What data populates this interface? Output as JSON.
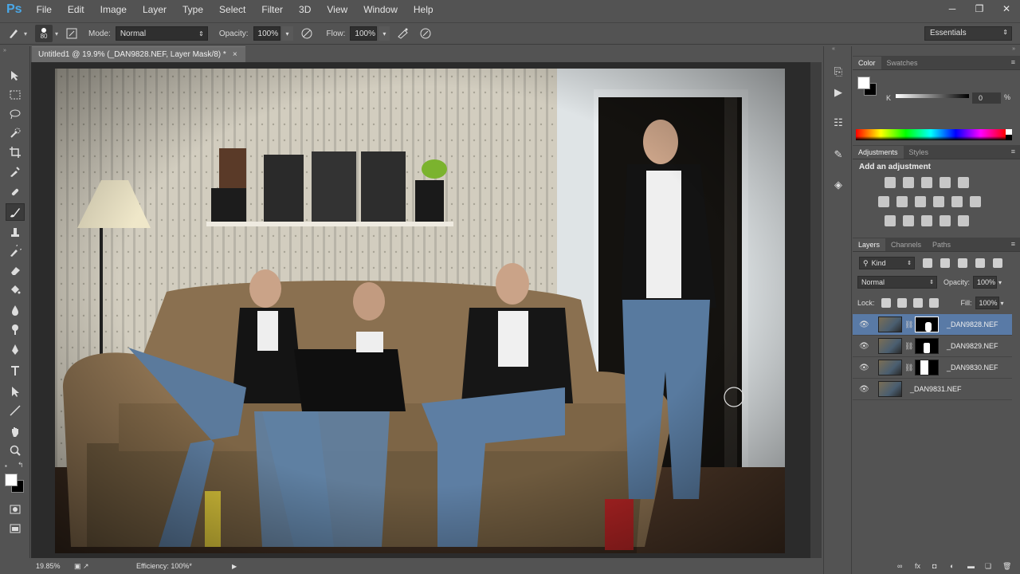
{
  "app": {
    "logo": "Ps"
  },
  "menu": [
    "File",
    "Edit",
    "Image",
    "Layer",
    "Type",
    "Select",
    "Filter",
    "3D",
    "View",
    "Window",
    "Help"
  ],
  "window_controls": {
    "minimize": "─",
    "restore": "❐",
    "close": "✕"
  },
  "options": {
    "brush_size": "80",
    "mode_label": "Mode:",
    "mode_value": "Normal",
    "opacity_label": "Opacity:",
    "opacity_value": "100%",
    "flow_label": "Flow:",
    "flow_value": "100%",
    "workspace": "Essentials"
  },
  "document": {
    "tab_title": "Untitled1 @ 19.9% (_DAN9828.NEF, Layer Mask/8) *",
    "close": "×"
  },
  "status": {
    "zoom": "19.85%",
    "efficiency": "Efficiency: 100%*"
  },
  "color_panel": {
    "tabs": [
      "Color",
      "Swatches"
    ],
    "k_label": "K",
    "k_value": "0",
    "k_unit": "%"
  },
  "adjustments_panel": {
    "tabs": [
      "Adjustments",
      "Styles"
    ],
    "heading": "Add an adjustment"
  },
  "layers_panel": {
    "tabs": [
      "Layers",
      "Channels",
      "Paths"
    ],
    "filter_kind": "Kind",
    "blend_mode": "Normal",
    "opacity_label": "Opacity:",
    "opacity_value": "100%",
    "lock_label": "Lock:",
    "fill_label": "Fill:",
    "fill_value": "100%",
    "layers": [
      {
        "name": "_DAN9828.NEF",
        "selected": true,
        "has_mask": true
      },
      {
        "name": "_DAN9829.NEF",
        "selected": false,
        "has_mask": true
      },
      {
        "name": "_DAN9830.NEF",
        "selected": false,
        "has_mask": true
      },
      {
        "name": "_DAN9831.NEF",
        "selected": false,
        "has_mask": false
      }
    ]
  },
  "colors": {
    "ui_bg": "#535353",
    "canvas_bg": "#2b2b2b",
    "selection": "#597aa6",
    "logo": "#4aa8e8"
  }
}
